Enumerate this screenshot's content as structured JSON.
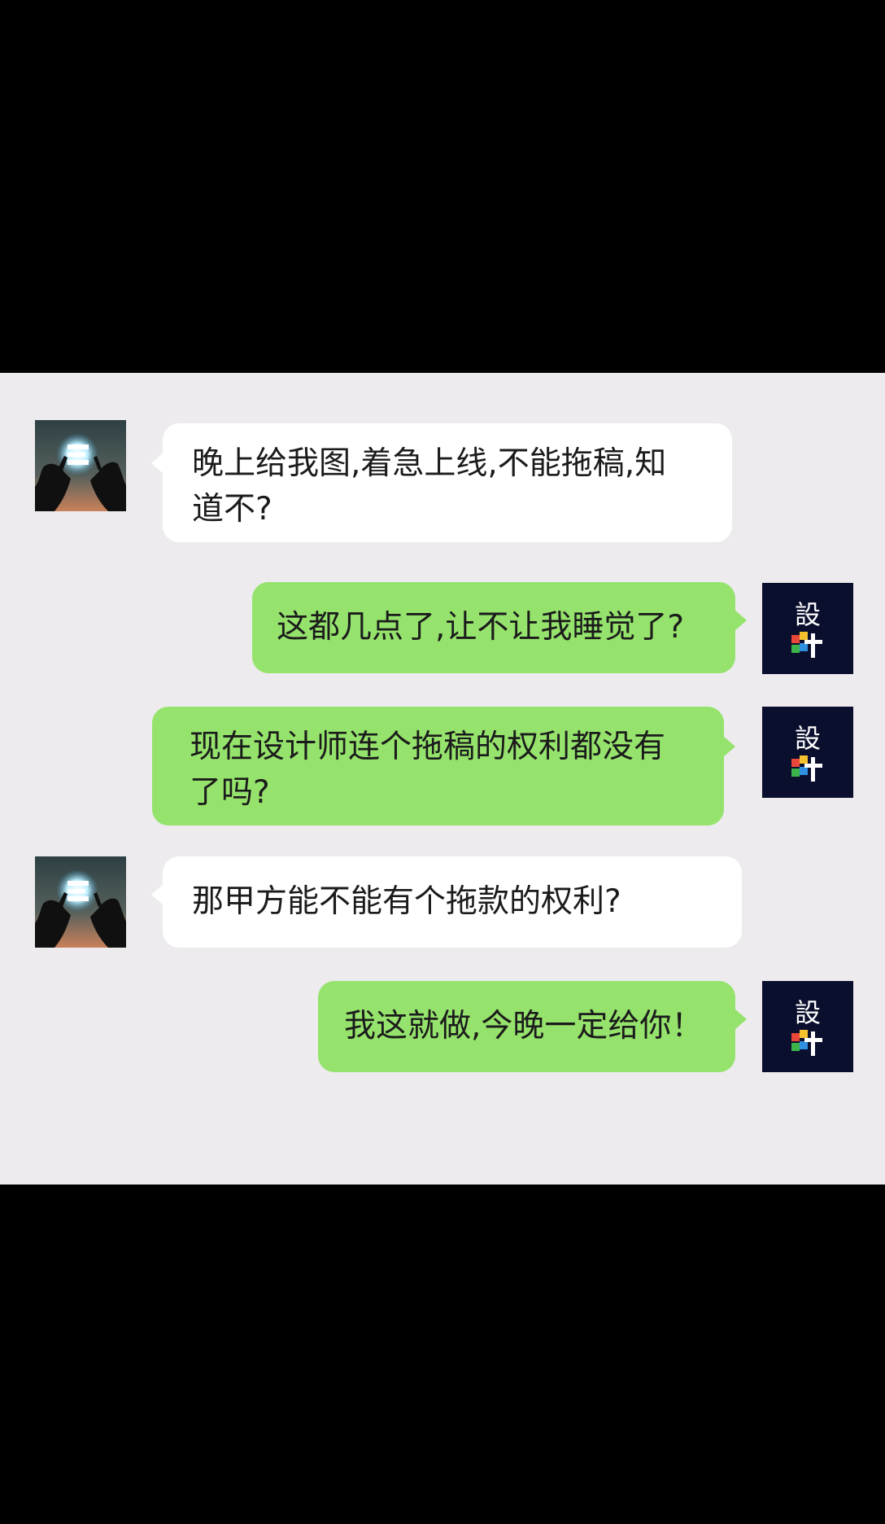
{
  "messages": [
    {
      "side": "left",
      "avatar": "raised-hands-avatar",
      "text": "晚上给我图,着急上线,不能拖稿,知\n道不?"
    },
    {
      "side": "right",
      "avatar": "design-logo-avatar",
      "text": "这都几点了,让不让我睡觉了?"
    },
    {
      "side": "right",
      "avatar": "design-logo-avatar",
      "text": "现在设计师连个拖稿的权利都没有\n了吗?"
    },
    {
      "side": "left",
      "avatar": "raised-hands-avatar",
      "text": "那甲方能不能有个拖款的权利?"
    },
    {
      "side": "right",
      "avatar": "design-logo-avatar",
      "text": "我这就做,今晚一定给你！"
    }
  ],
  "logo_text": "設計",
  "colors": {
    "chat_background": "#edebee",
    "left_bubble": "#ffffff",
    "right_bubble": "#95e36c",
    "letterbox": "#000000"
  }
}
